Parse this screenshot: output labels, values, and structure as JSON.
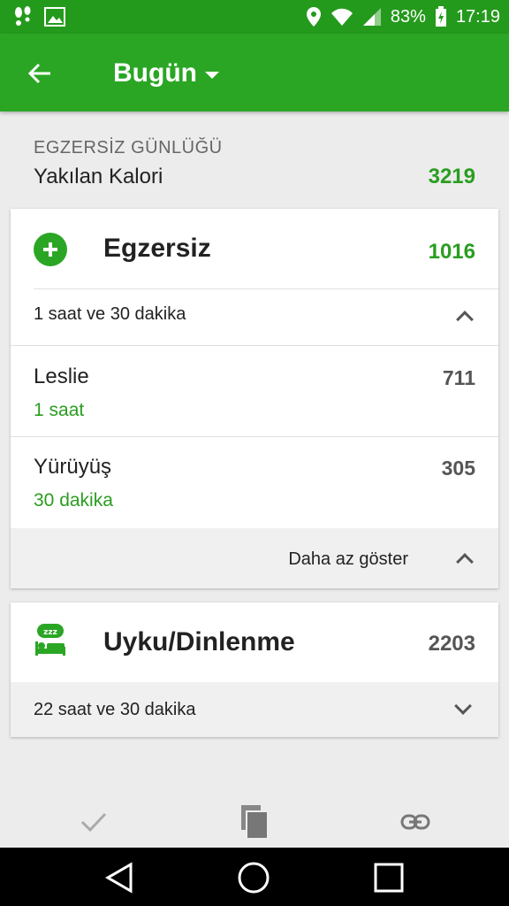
{
  "status_bar": {
    "battery": "83%",
    "time": "17:19"
  },
  "app_bar": {
    "title": "Bugün"
  },
  "summary": {
    "section_label": "EGZERSİZ GÜNLÜĞÜ",
    "calories_label": "Yakılan Kalori",
    "calories_value": "3219"
  },
  "exercise_card": {
    "title": "Egzersiz",
    "total": "1016",
    "duration": "1 saat ve 30 dakika",
    "items": [
      {
        "name": "Leslie",
        "duration": "1 saat",
        "calories": "711"
      },
      {
        "name": "Yürüyüş",
        "duration": "30 dakika",
        "calories": "305"
      }
    ],
    "show_less_label": "Daha az göster"
  },
  "sleep_card": {
    "title": "Uyku/Dinlenme",
    "total": "2203",
    "duration": "22 saat ve 30 dakika"
  },
  "colors": {
    "brand_green": "#2aa624",
    "value_green": "#2a9d20"
  },
  "icons": [
    "back-arrow-icon",
    "dropdown-caret-icon",
    "add-icon",
    "sleep-icon",
    "check-icon",
    "copy-icon",
    "link-icon"
  ]
}
